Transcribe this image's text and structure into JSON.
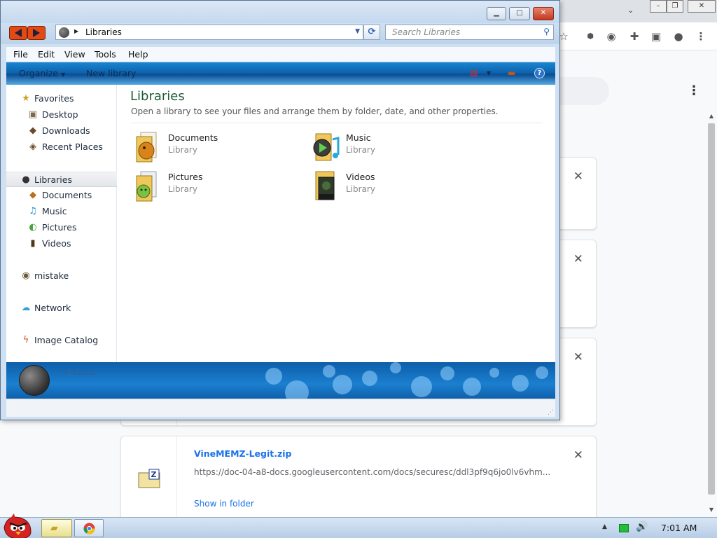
{
  "explorer": {
    "address": "Libraries",
    "search_placeholder": "Search Libraries",
    "menu": [
      "File",
      "Edit",
      "View",
      "Tools",
      "Help"
    ],
    "toolbar": {
      "organize": "Organize",
      "new_library": "New library"
    },
    "nav": {
      "favorites": "Favorites",
      "desktop": "Desktop",
      "downloads": "Downloads",
      "recent": "Recent Places",
      "libraries": "Libraries",
      "documents": "Documents",
      "music": "Music",
      "pictures": "Pictures",
      "videos": "Videos",
      "homegroup": "mistake",
      "network": "Network",
      "image_catalog": "Image Catalog"
    },
    "content": {
      "title": "Libraries",
      "subtitle": "Open a library to see your files and arrange them by folder, date, and other properties.",
      "items": [
        {
          "name": "Documents",
          "type": "Library",
          "icon": "documents-library-icon"
        },
        {
          "name": "Music",
          "type": "Library",
          "icon": "music-library-icon"
        },
        {
          "name": "Pictures",
          "type": "Library",
          "icon": "pictures-library-icon"
        },
        {
          "name": "Videos",
          "type": "Library",
          "icon": "videos-library-icon"
        }
      ]
    },
    "details_count": "4 items"
  },
  "download": {
    "filename": "VineMEMZ-Legit.zip",
    "url": "https://doc-04-a8-docs.googleusercontent.com/docs/securesc/ddl3pf9q6jo0lv6vhm...",
    "show_in_folder": "Show in folder"
  },
  "taskbar": {
    "clock": "7:01 AM"
  },
  "colors": {
    "link": "#1a73e8",
    "library_title": "#1e5b39",
    "command_bar": "#0f63ad",
    "close_button": "#c23a21"
  }
}
